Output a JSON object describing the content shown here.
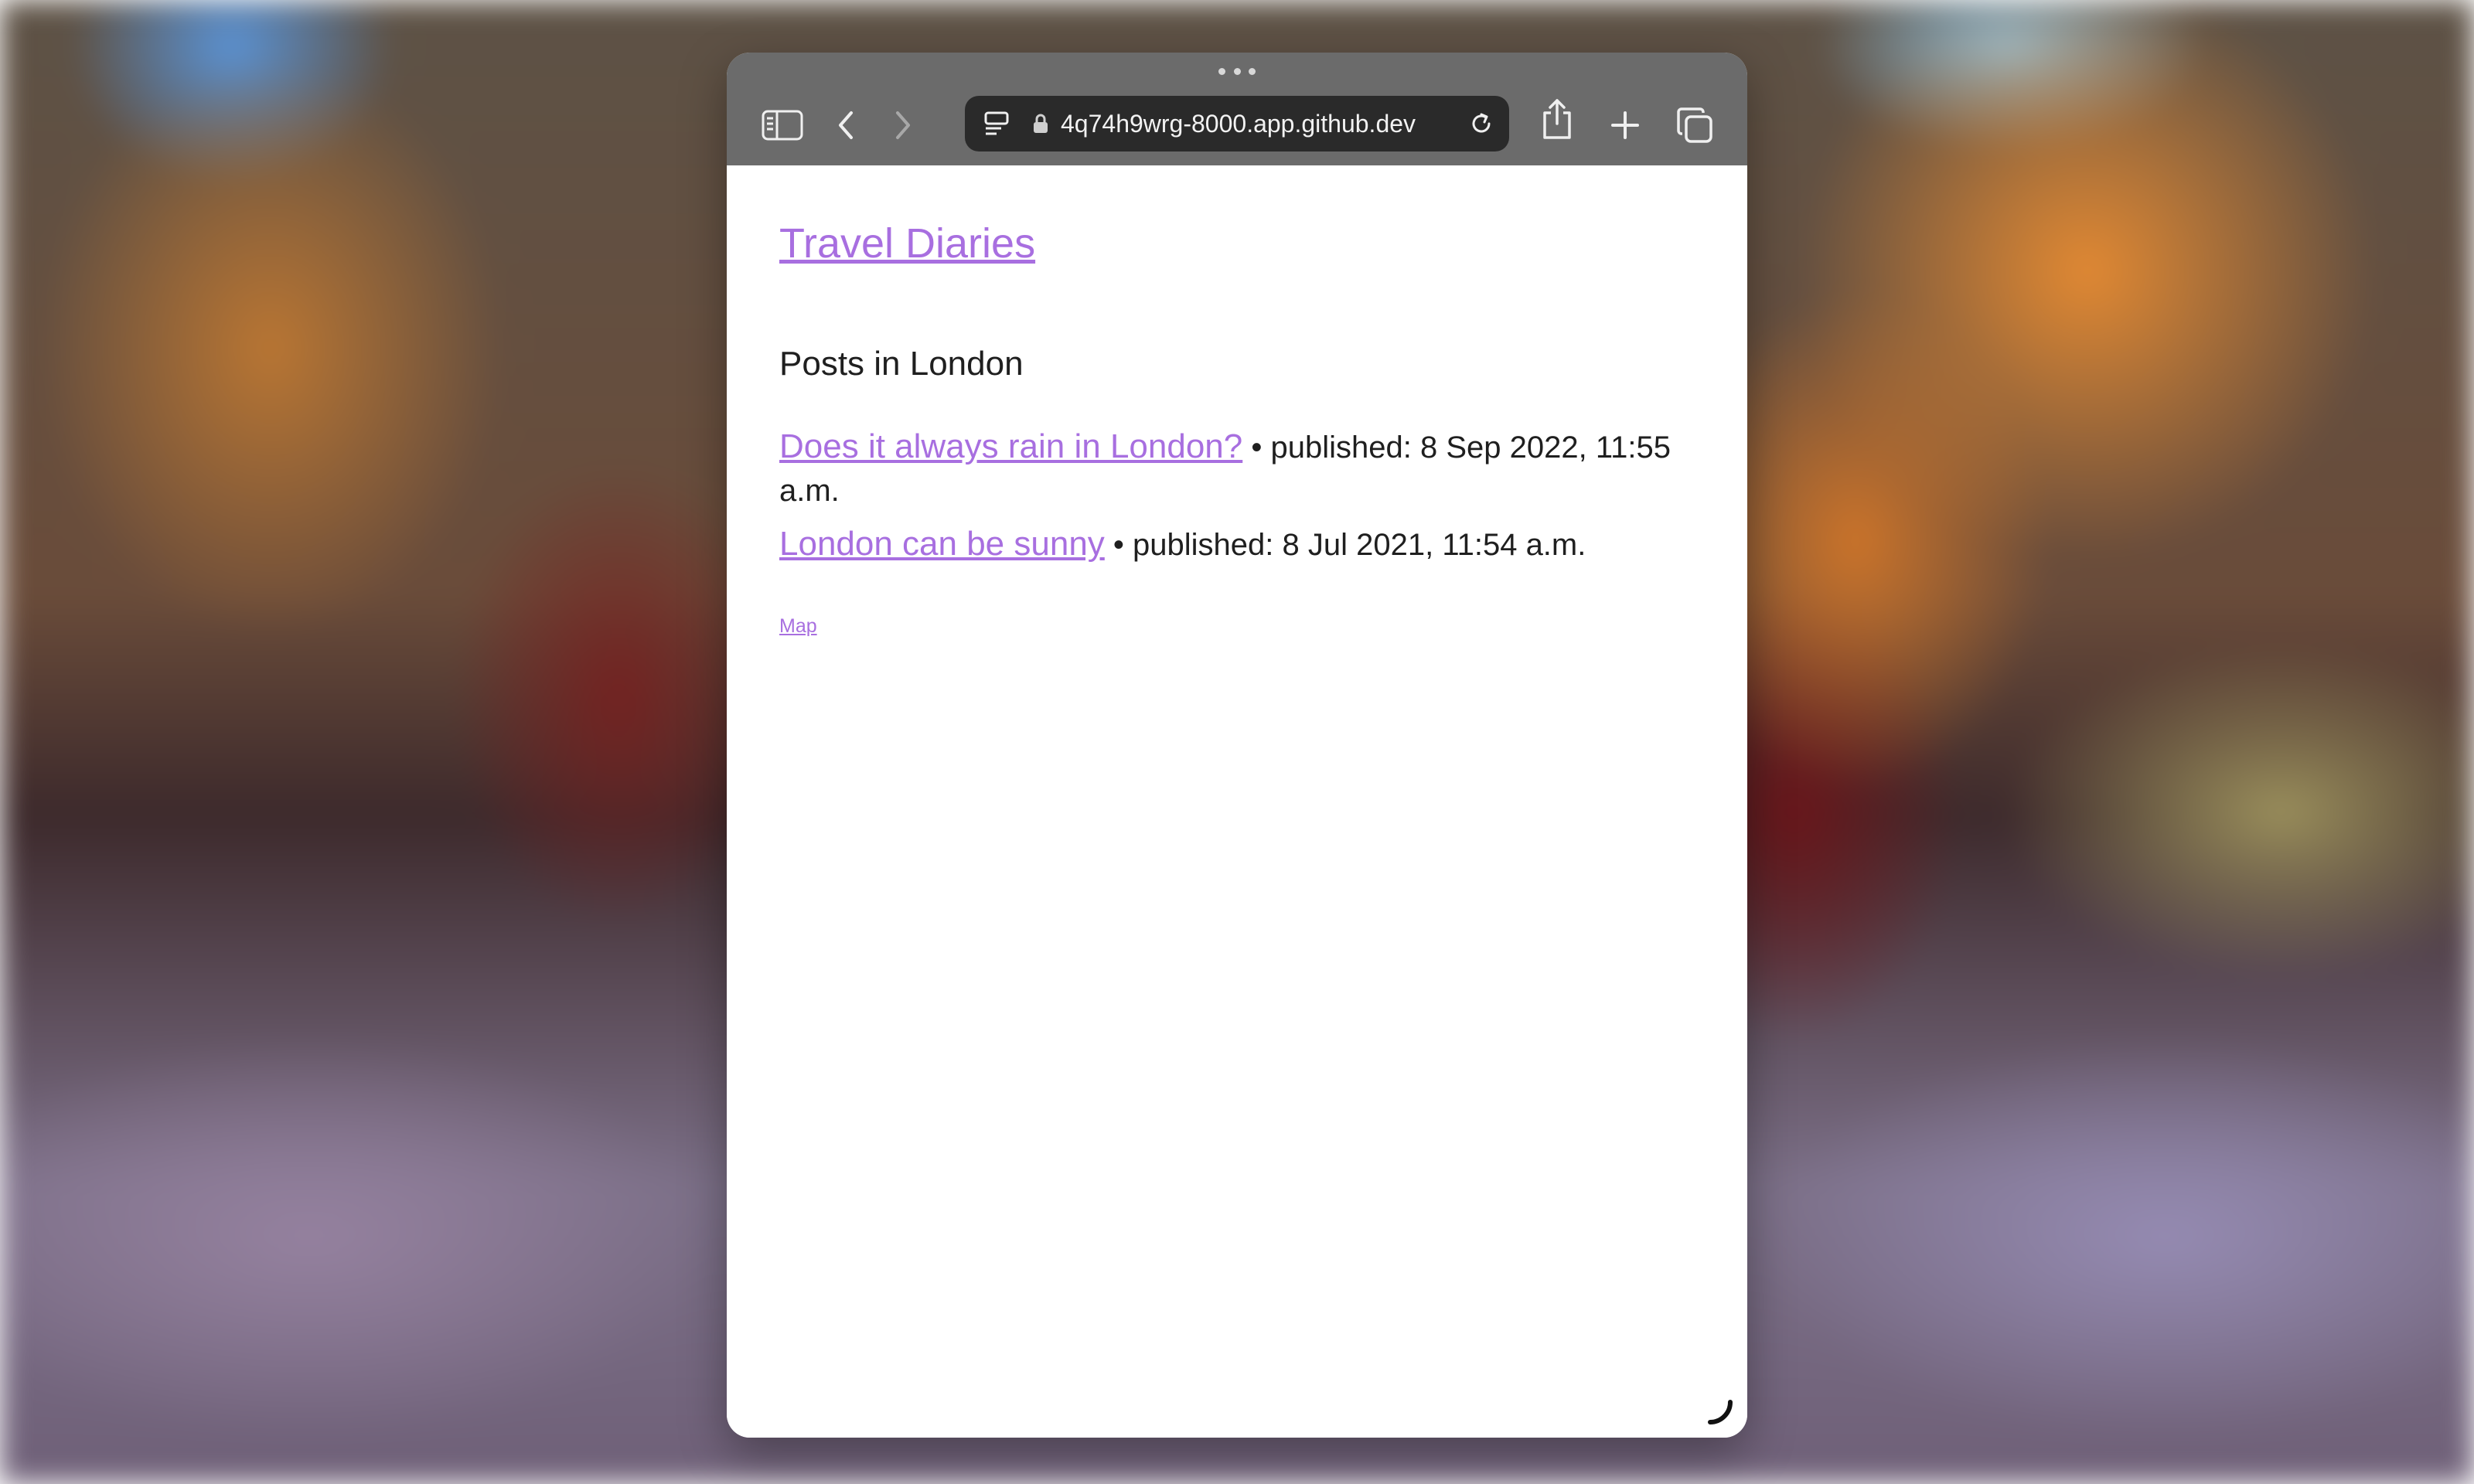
{
  "browser": {
    "url": "4q74h9wrg-8000.app.github.dev",
    "icons": {
      "sidebar": "sidebar-icon",
      "back": "chevron-left-icon",
      "forward": "chevron-right-icon",
      "tab_overview": "page-menu-icon",
      "lock": "lock-icon",
      "reload": "reload-icon",
      "share": "share-icon",
      "new_tab": "plus-icon",
      "tabs": "tabs-icon",
      "grabber": "ellipsis-icon"
    }
  },
  "page": {
    "site_title": "Travel Diaries",
    "heading": "Posts in London",
    "posts": [
      {
        "title": "Does it always rain in London?",
        "meta": " • published: 8 Sep 2022, 11:55 a.m."
      },
      {
        "title": "London can be sunny",
        "meta": " • published: 8 Jul 2021, 11:54 a.m."
      }
    ],
    "map_link": "Map"
  },
  "colors": {
    "link": "#a86fe0",
    "text": "#1f1f1f",
    "toolbar": "#6b6b6b",
    "addressbar": "#2a2a2a"
  }
}
